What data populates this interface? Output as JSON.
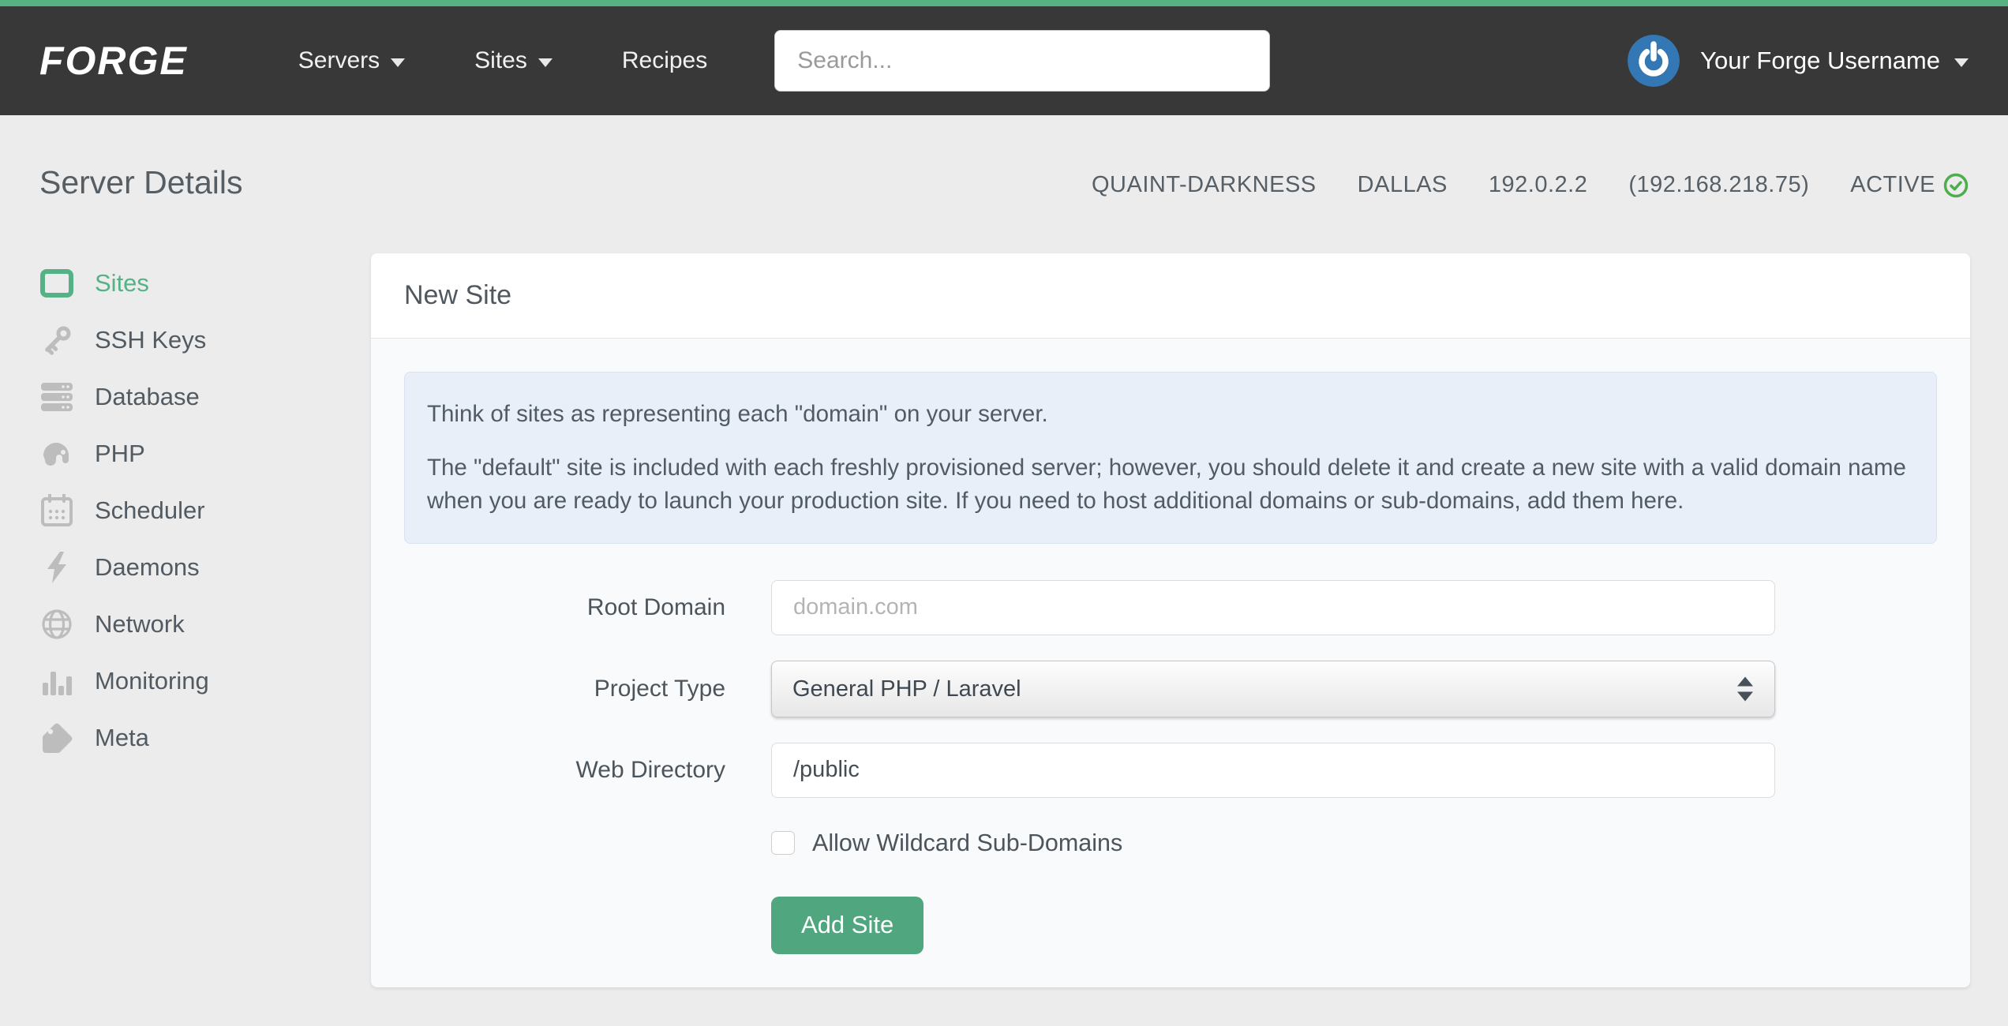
{
  "colors": {
    "accent_green": "#55b287",
    "top_strip_green": "#57b183",
    "navbar_dark": "#383838",
    "button_green": "#50a67e",
    "status_green": "#4cae4c",
    "avatar_blue": "#3377b5",
    "info_box_bg": "#e9eff9"
  },
  "nav": {
    "logo": "FORGE",
    "items": [
      {
        "label": "Servers",
        "has_caret": true
      },
      {
        "label": "Sites",
        "has_caret": true
      },
      {
        "label": "Recipes",
        "has_caret": false
      }
    ],
    "search_placeholder": "Search...",
    "user": {
      "name": "Your Forge Username",
      "avatar_icon": "power-icon"
    }
  },
  "header": {
    "title": "Server Details",
    "server": {
      "name": "QUAINT-DARKNESS",
      "region": "DALLAS",
      "ip": "192.0.2.2",
      "private_ip": "(192.168.218.75)",
      "status": "ACTIVE",
      "status_icon": "check-circle-icon"
    }
  },
  "sidebar": {
    "items": [
      {
        "label": "Sites",
        "icon": "browser-icon",
        "active": true
      },
      {
        "label": "SSH Keys",
        "icon": "key-icon",
        "active": false
      },
      {
        "label": "Database",
        "icon": "database-icon",
        "active": false
      },
      {
        "label": "PHP",
        "icon": "elephant-icon",
        "active": false
      },
      {
        "label": "Scheduler",
        "icon": "calendar-icon",
        "active": false
      },
      {
        "label": "Daemons",
        "icon": "lightning-icon",
        "active": false
      },
      {
        "label": "Network",
        "icon": "globe-icon",
        "active": false
      },
      {
        "label": "Monitoring",
        "icon": "bar-chart-icon",
        "active": false
      },
      {
        "label": "Meta",
        "icon": "tag-icon",
        "active": false
      }
    ]
  },
  "panel": {
    "title": "New Site",
    "info": {
      "p1": "Think of sites as representing each \"domain\" on your server.",
      "p2": "The \"default\" site is included with each freshly provisioned server; however, you should delete it and create a new site with a valid domain name when you are ready to launch your production site. If you need to host additional domains or sub-domains, add them here."
    },
    "form": {
      "root_domain": {
        "label": "Root Domain",
        "placeholder": "domain.com",
        "value": ""
      },
      "project_type": {
        "label": "Project Type",
        "value": "General PHP / Laravel"
      },
      "web_directory": {
        "label": "Web Directory",
        "value": "/public"
      },
      "wildcard": {
        "label": "Allow Wildcard Sub-Domains",
        "checked": false
      },
      "submit_label": "Add Site"
    }
  }
}
